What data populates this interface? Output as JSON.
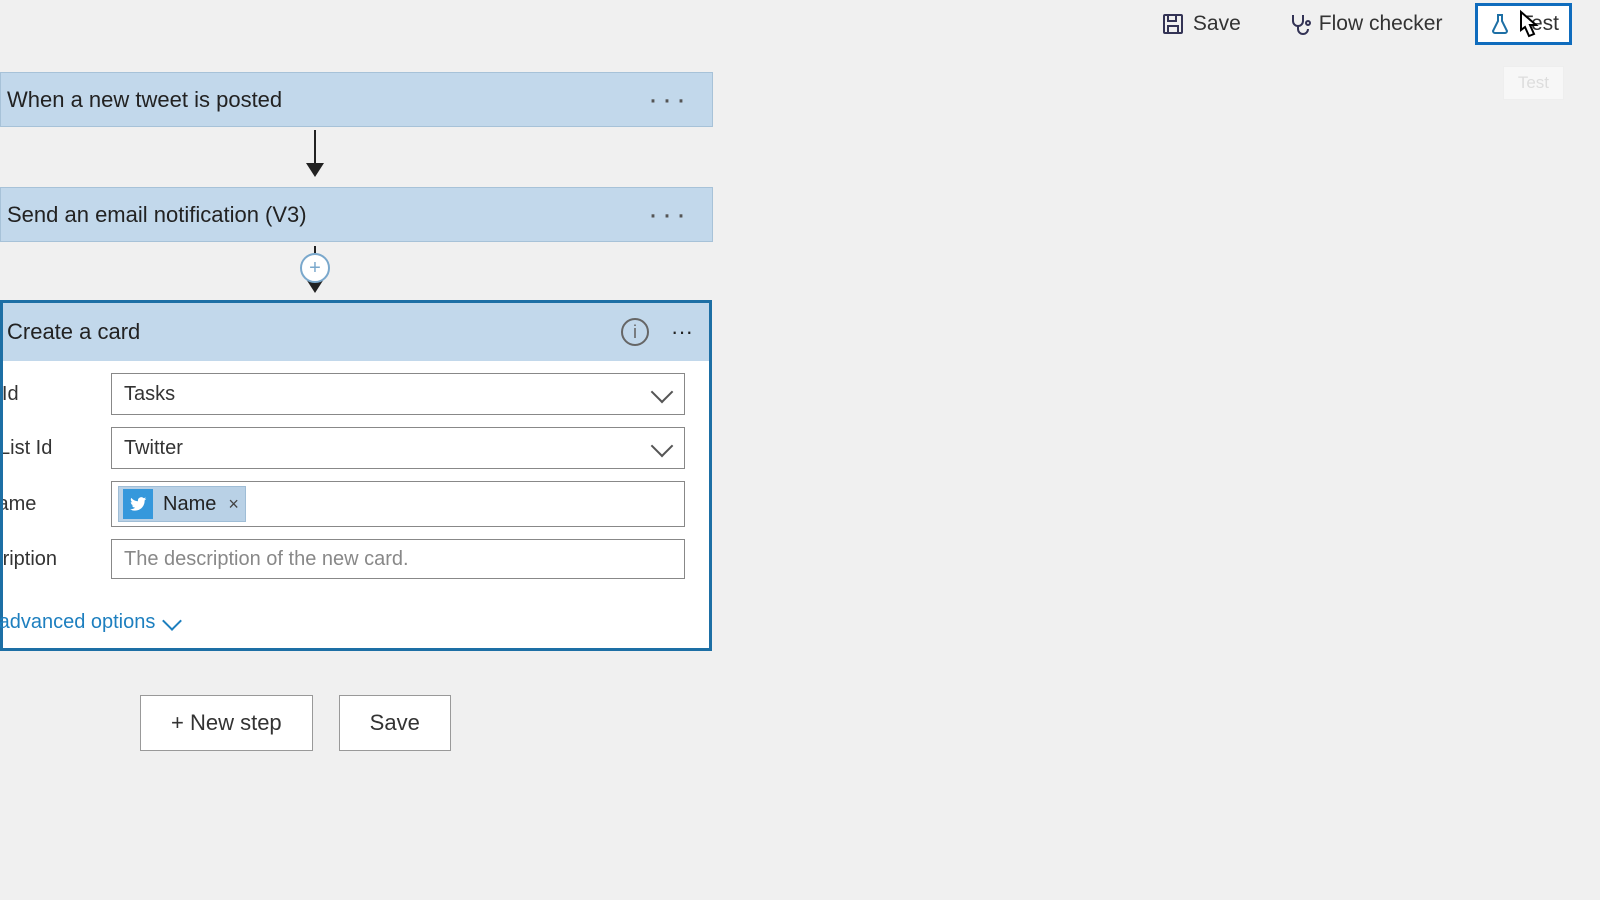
{
  "topbar": {
    "save": "Save",
    "flow_checker": "Flow checker",
    "test": "Test",
    "tooltip": "Test"
  },
  "steps": {
    "trigger": "When a new tweet is posted",
    "action1": "Send an email notification (V3)",
    "action2": {
      "title": "Create a card",
      "fields": {
        "board_label": "Board Id",
        "board_value": "Tasks",
        "list_label": "List Id",
        "list_value": "Twitter",
        "name_label": "Name",
        "name_token": "Name",
        "desc_label": "Description",
        "desc_placeholder": "The description of the new card."
      },
      "advanced": "Show advanced options"
    }
  },
  "footer": {
    "new_step": "+ New step",
    "save": "Save"
  }
}
